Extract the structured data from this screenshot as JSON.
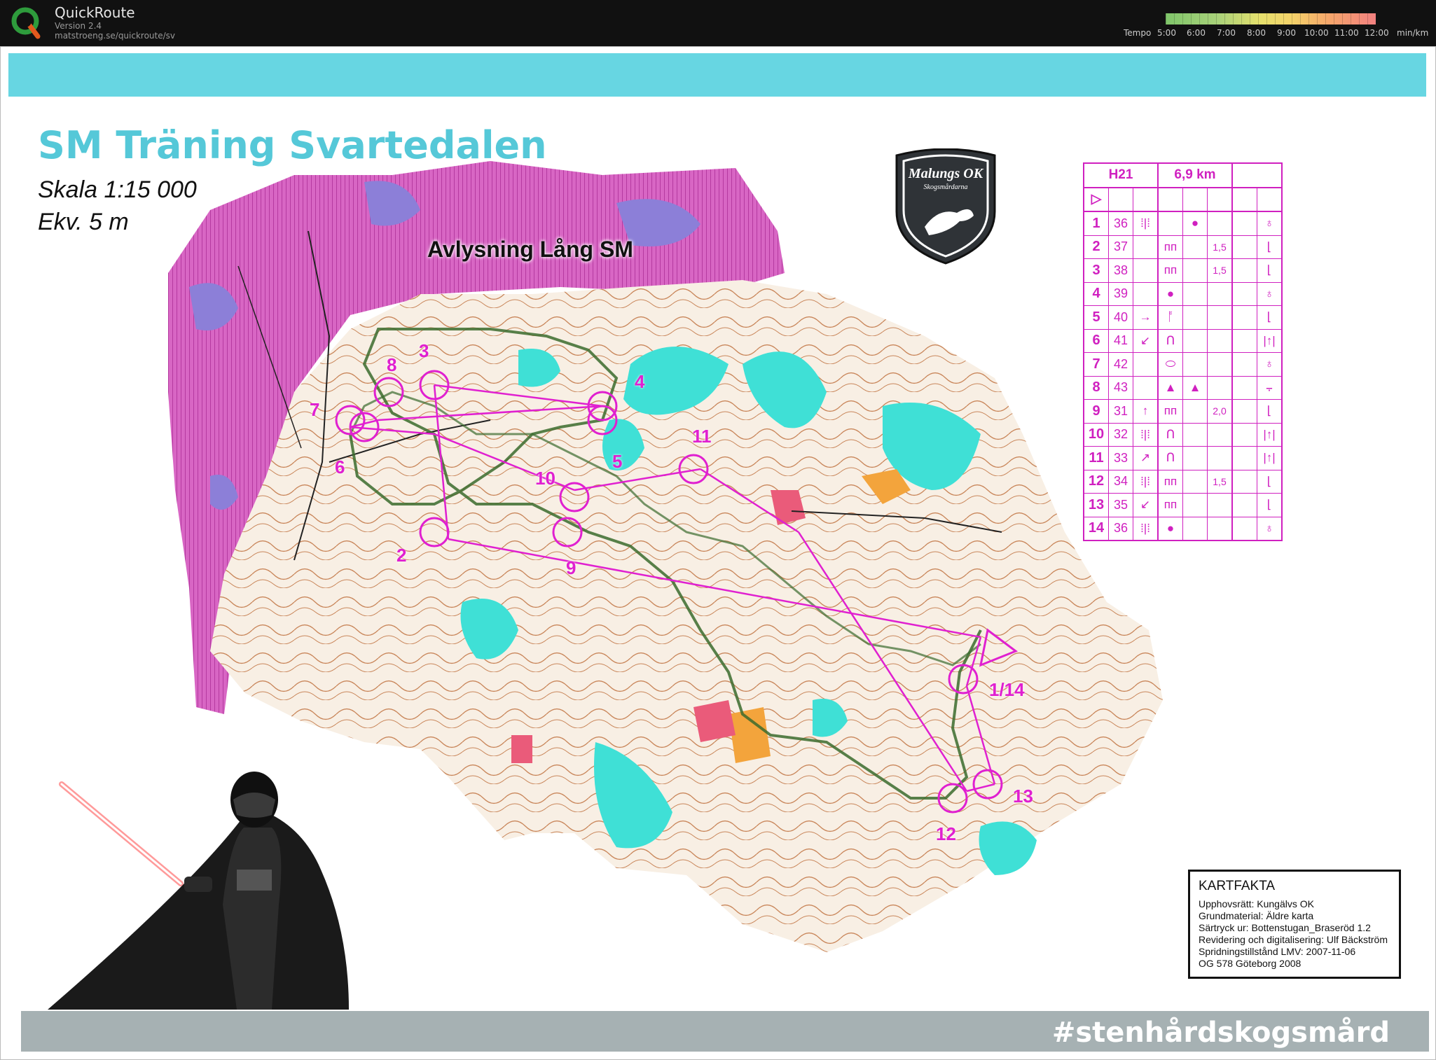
{
  "app": {
    "name": "QuickRoute",
    "version": "Version 2.4",
    "url": "matstroeng.se/quickroute/sv"
  },
  "tempo": {
    "label": "Tempo",
    "ticks": [
      "5:00",
      "6:00",
      "7:00",
      "8:00",
      "9:00",
      "10:00",
      "11:00",
      "12:00"
    ],
    "unit": "min/km",
    "colors": [
      "#7fc56a",
      "#e6e06d",
      "#f28080"
    ]
  },
  "map": {
    "title": "SM Träning Svartedalen",
    "scale": "Skala 1:15 000",
    "equidistance": "Ekv. 5 m",
    "cancelled_area_label": "Avlysning Lång SM",
    "club_logo_text": "Malungs OK",
    "club_logo_subtext": "Skogsmårdarna",
    "controls": [
      {
        "label": "1/14"
      },
      {
        "label": "2"
      },
      {
        "label": "3"
      },
      {
        "label": "4"
      },
      {
        "label": "5"
      },
      {
        "label": "6"
      },
      {
        "label": "7"
      },
      {
        "label": "8"
      },
      {
        "label": "9"
      },
      {
        "label": "10"
      },
      {
        "label": "11"
      },
      {
        "label": "12"
      },
      {
        "label": "13"
      }
    ],
    "colors": {
      "course": "#e020d0",
      "water": "#3fe0d6",
      "forbidden": "#d24fb8",
      "terrain": "#f7efe2",
      "route": "#3b6b2d"
    }
  },
  "control_descriptions": {
    "class": "H21",
    "length": "6,9 km",
    "start_symbol": "▷",
    "rows": [
      {
        "num": "1",
        "code": "36",
        "c": "⁞|⁞",
        "d": "",
        "e": "●",
        "f": "",
        "g": "",
        "h": "♁"
      },
      {
        "num": "2",
        "code": "37",
        "c": "",
        "d": "",
        "e": "ᴨᴨ",
        "f": "",
        "g": "1,5",
        "h": "⌊"
      },
      {
        "num": "3",
        "code": "38",
        "c": "",
        "d": "",
        "e": "ᴨᴨ",
        "f": "",
        "g": "1,5",
        "h": "⌊"
      },
      {
        "num": "4",
        "code": "39",
        "c": "",
        "d": "",
        "e": "●",
        "f": "",
        "g": "",
        "h": "♁"
      },
      {
        "num": "5",
        "code": "40",
        "c": "→",
        "d": "ᚩ",
        "e": "",
        "f": "",
        "g": "",
        "h": "⌊"
      },
      {
        "num": "6",
        "code": "41",
        "c": "↙",
        "d": "ᑎ",
        "e": "",
        "f": "",
        "g": "",
        "h": "|↑|"
      },
      {
        "num": "7",
        "code": "42",
        "c": "",
        "d": "⬭",
        "e": "",
        "f": "",
        "g": "",
        "h": "♁"
      },
      {
        "num": "8",
        "code": "43",
        "c": "",
        "d": "▲",
        "e": "▲",
        "f": "",
        "g": "",
        "h": "⨪"
      },
      {
        "num": "9",
        "code": "31",
        "c": "↑",
        "d": "ᴨᴨ",
        "e": "",
        "f": "",
        "g": "2,0",
        "h": "⌊"
      },
      {
        "num": "10",
        "code": "32",
        "c": "⁞|⁞",
        "d": "ᑎ",
        "e": "",
        "f": "",
        "g": "",
        "h": "|↑|"
      },
      {
        "num": "11",
        "code": "33",
        "c": "↗",
        "d": "ᑎ",
        "e": "",
        "f": "",
        "g": "",
        "h": "|↑|"
      },
      {
        "num": "12",
        "code": "34",
        "c": "⁞|⁞",
        "d": "ᴨᴨ",
        "e": "",
        "f": "",
        "g": "1,5",
        "h": "⌊"
      },
      {
        "num": "13",
        "code": "35",
        "c": "↙",
        "d": "ᴨᴨ",
        "e": "",
        "f": "",
        "g": "",
        "h": "⌊"
      },
      {
        "num": "14",
        "code": "36",
        "c": "⁞|⁞",
        "d": "●",
        "e": "",
        "f": "",
        "g": "",
        "h": "♁"
      }
    ]
  },
  "kartfakta": {
    "title": "KARTFAKTA",
    "lines": [
      "Upphovsrätt: Kungälvs OK",
      "Grundmaterial: Äldre karta",
      "Särtryck ur: Bottenstugan_Braseröd 1.2",
      "Revidering och digitalisering: Ulf Bäckström",
      "Spridningstillstånd LMV: 2007-11-06",
      "OG 578 Göteborg 2008"
    ]
  },
  "footer": {
    "hashtag": "#stenhårdskogsmård"
  }
}
